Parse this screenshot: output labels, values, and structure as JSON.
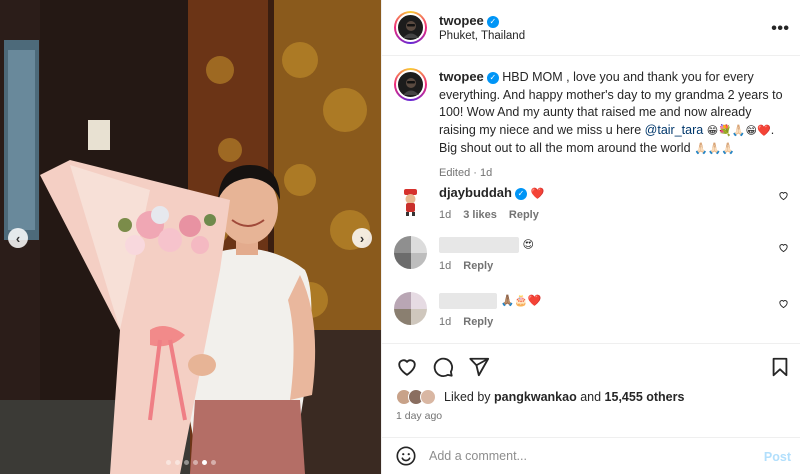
{
  "post": {
    "username": "twopee",
    "location": "Phuket, Thailand",
    "caption": {
      "username": "twopee",
      "text_1": " HBD MOM , love you and thank you for every everything. And happy mother's day to my grandma 2 years to 100! Wow And my aunty that raised me and now already raising my niece and we miss u here ",
      "mention": "@tair_tara",
      "emojis_1": "😁💐🙏🏻😁❤️",
      "text_2": ". Big shout out to all the mom around the world ",
      "emojis_2": "🙏🏻🙏🏻🙏🏻",
      "edited": "Edited · 1d"
    },
    "comments": [
      {
        "username": "djaybuddah",
        "text": "❤️",
        "time": "1d",
        "likes": "3 likes",
        "reply": "Reply"
      },
      {
        "username": "",
        "text": "😍",
        "time": "1d",
        "reply": "Reply"
      },
      {
        "username": "",
        "text": "🙏🏽🎂❤️",
        "time": "1d",
        "reply": "Reply"
      }
    ],
    "likes": {
      "prefix": "Liked by",
      "user": "pangkwankao",
      "joiner": "and",
      "others": "15,455 others"
    },
    "timestamp": "1 day ago",
    "add_comment": {
      "placeholder": "Add a comment...",
      "post_label": "Post"
    },
    "carousel": {
      "total": 6,
      "active_index": 4
    },
    "more_icon": "more-horizontal-icon",
    "colors": {
      "verified": "#0095f6",
      "mention": "#00376b",
      "post_disabled": "#b2dffc",
      "heart": "#e8243c"
    }
  }
}
